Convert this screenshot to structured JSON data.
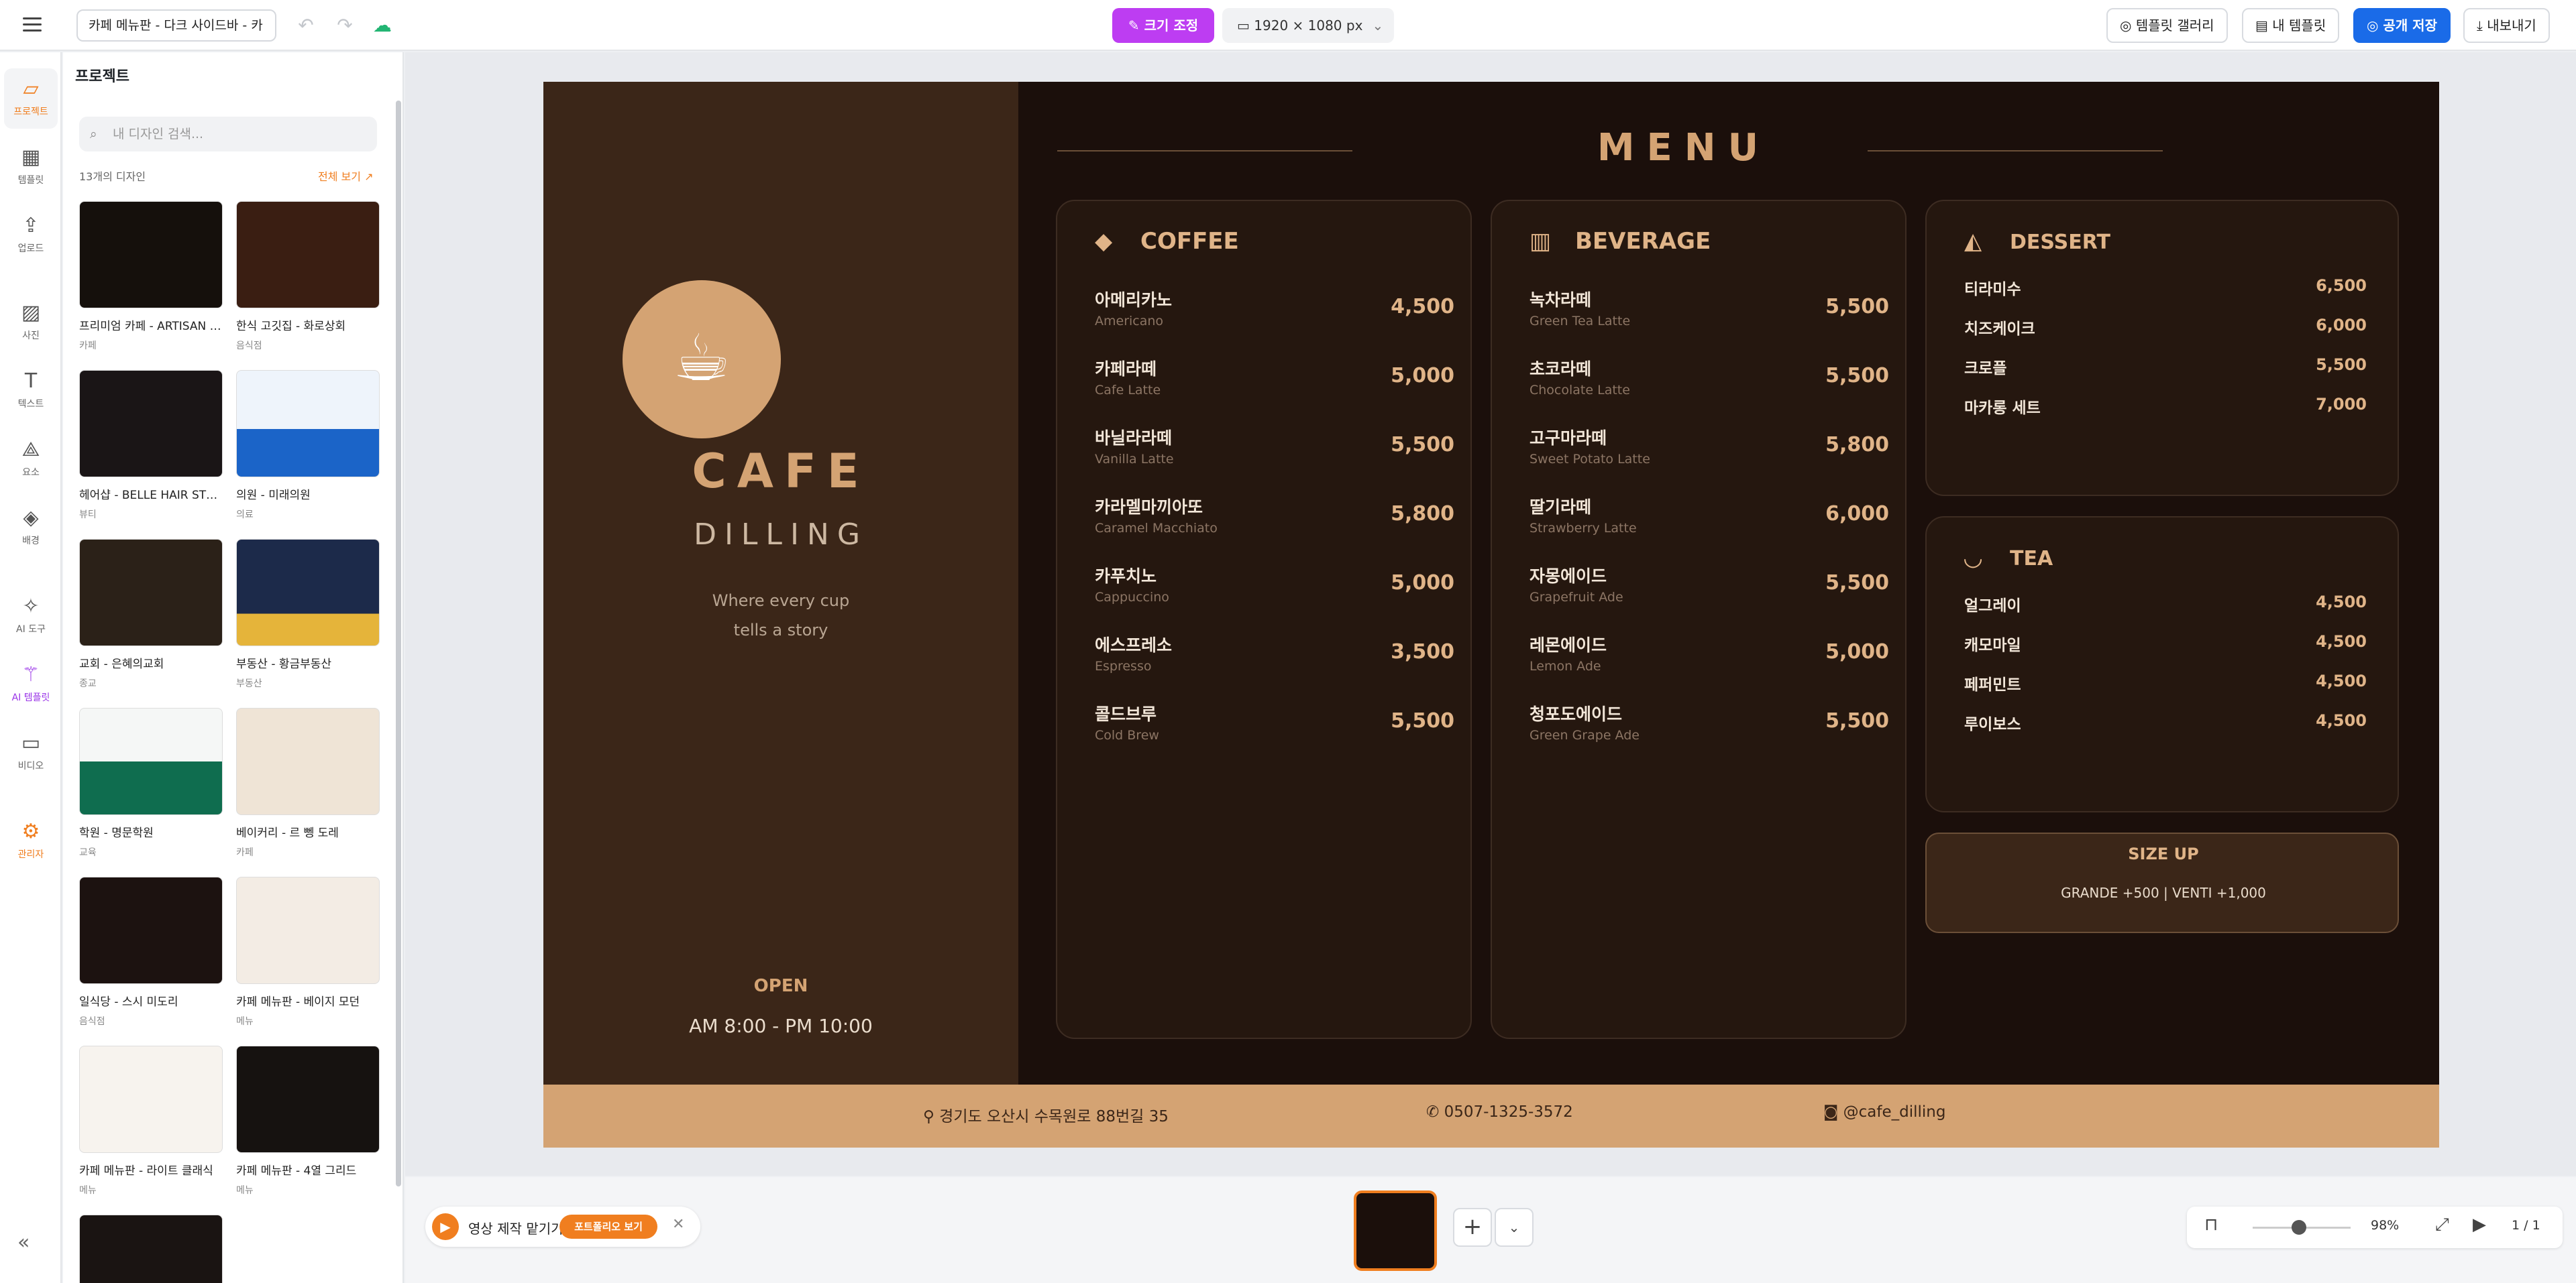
{
  "topbar": {
    "doc_name": "카페 메뉴판 - 다크 사이드바 - 카",
    "undo_icon": "undo-icon",
    "redo_icon": "redo-icon",
    "cloud_icon": "cloud-save-icon",
    "resize_label": "크기 조정",
    "canvas_size": "1920 × 1080 px",
    "template_gallery": "템플릿 갤러리",
    "my_templates": "내 템플릿",
    "publish": "공개 저장",
    "export": "내보내기"
  },
  "leftnav": {
    "items": [
      {
        "label": "프로젝트",
        "icon": "folder-icon"
      },
      {
        "label": "템플릿",
        "icon": "template-icon"
      },
      {
        "label": "업로드",
        "icon": "upload-icon"
      },
      {
        "label": "사진",
        "icon": "image-icon"
      },
      {
        "label": "텍스트",
        "icon": "text-icon"
      },
      {
        "label": "요소",
        "icon": "shapes-icon"
      },
      {
        "label": "배경",
        "icon": "paint-bucket-icon"
      },
      {
        "label": "AI 도구",
        "icon": "sparkle-icon"
      },
      {
        "label": "AI 템플릿",
        "icon": "magic-wand-icon"
      },
      {
        "label": "비디오",
        "icon": "video-icon"
      },
      {
        "label": "관리자",
        "icon": "gear-icon"
      }
    ]
  },
  "panel": {
    "title": "프로젝트",
    "search_placeholder": "내 디자인 검색...",
    "count": "13개의 디자인",
    "view_all": "전체 보기",
    "designs": [
      {
        "title": "프리미엄 카페 - ARTISAN COFFEE",
        "category": "카페"
      },
      {
        "title": "한식 고깃집 - 화로상회",
        "category": "음식점"
      },
      {
        "title": "헤어샵 - BELLE HAIR STUDIO",
        "category": "뷰티"
      },
      {
        "title": "의원 - 미래의원",
        "category": "의료"
      },
      {
        "title": "교회 - 은혜의교회",
        "category": "종교"
      },
      {
        "title": "부동산 - 황금부동산",
        "category": "부동산"
      },
      {
        "title": "학원 - 명문학원",
        "category": "교육"
      },
      {
        "title": "베이커리 - 르 뼁 도레",
        "category": "카페"
      },
      {
        "title": "일식당 - 스시 미도리",
        "category": "음식점"
      },
      {
        "title": "카페 메뉴판 - 베이지 모던",
        "category": "메뉴"
      },
      {
        "title": "카페 메뉴판 - 라이트 클래식",
        "category": "메뉴"
      },
      {
        "title": "카페 메뉴판 - 4열 그리드",
        "category": "메뉴"
      }
    ]
  },
  "menu": {
    "brand": "CAFE",
    "sub": "DILLING",
    "tagline1": "Where every cup",
    "tagline2": "tells a story",
    "open": "OPEN",
    "hours": "AM 8:00 - PM 10:00",
    "title": "MENU",
    "coffee": {
      "heading": "COFFEE",
      "items": [
        {
          "ko": "아메리카노",
          "en": "Americano",
          "price": "4,500"
        },
        {
          "ko": "카페라떼",
          "en": "Cafe Latte",
          "price": "5,000"
        },
        {
          "ko": "바닐라라떼",
          "en": "Vanilla Latte",
          "price": "5,500"
        },
        {
          "ko": "카라멜마끼아또",
          "en": "Caramel Macchiato",
          "price": "5,800"
        },
        {
          "ko": "카푸치노",
          "en": "Cappuccino",
          "price": "5,000"
        },
        {
          "ko": "에스프레소",
          "en": "Espresso",
          "price": "3,500"
        },
        {
          "ko": "콜드브루",
          "en": "Cold Brew",
          "price": "5,500"
        }
      ]
    },
    "beverage": {
      "heading": "BEVERAGE",
      "items": [
        {
          "ko": "녹차라떼",
          "en": "Green Tea Latte",
          "price": "5,500"
        },
        {
          "ko": "초코라떼",
          "en": "Chocolate Latte",
          "price": "5,500"
        },
        {
          "ko": "고구마라떼",
          "en": "Sweet Potato Latte",
          "price": "5,800"
        },
        {
          "ko": "딸기라떼",
          "en": "Strawberry Latte",
          "price": "6,000"
        },
        {
          "ko": "자몽에이드",
          "en": "Grapefruit Ade",
          "price": "5,500"
        },
        {
          "ko": "레몬에이드",
          "en": "Lemon Ade",
          "price": "5,000"
        },
        {
          "ko": "청포도에이드",
          "en": "Green Grape Ade",
          "price": "5,500"
        }
      ]
    },
    "dessert": {
      "heading": "DESSERT",
      "items": [
        {
          "name": "티라미수",
          "price": "6,500"
        },
        {
          "name": "치즈케이크",
          "price": "6,000"
        },
        {
          "name": "크로플",
          "price": "5,500"
        },
        {
          "name": "마카롱 세트",
          "price": "7,000"
        }
      ]
    },
    "tea": {
      "heading": "TEA",
      "items": [
        {
          "name": "얼그레이",
          "price": "4,500"
        },
        {
          "name": "캐모마일",
          "price": "4,500"
        },
        {
          "name": "페퍼민트",
          "price": "4,500"
        },
        {
          "name": "루이보스",
          "price": "4,500"
        }
      ]
    },
    "sizeup_title": "SIZE UP",
    "sizeup_text": "GRANDE +500  |  VENTI +1,000",
    "address": "경기도 오산시 수목원로 88번길 35",
    "phone": "0507-1325-3572",
    "instagram": "@cafe_dilling"
  },
  "bottombar": {
    "video_text": "영상 제작 맡기기",
    "portfolio": "포트폴리오 보기",
    "zoom": "98%",
    "page": "1 / 1"
  },
  "colors": {
    "accent": "#f07e1f",
    "primary": "#1a6be8",
    "resize": "#bd3df2",
    "menu_bg": "#1b0f0b",
    "menu_gold": "#d4a373"
  }
}
